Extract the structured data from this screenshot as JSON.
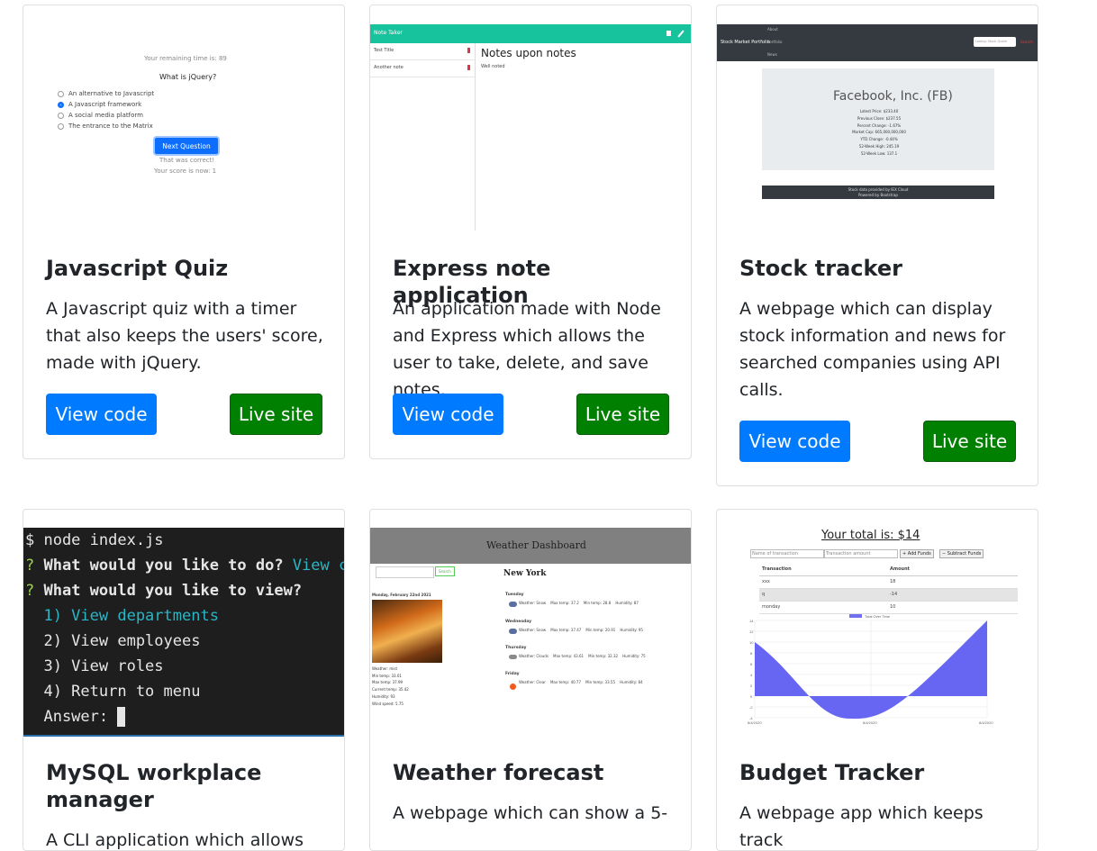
{
  "cards": [
    {
      "title": "Javascript Quiz",
      "text": "A Javascript quiz with a timer that also keeps the users' score, made with jQuery.",
      "view_label": "View code",
      "live_label": "Live site",
      "thumb": {
        "timer": "Your remaining time is: 89",
        "question": "What is jQuery?",
        "options": [
          "An alternative to Javascript",
          "A Javascript framework",
          "A social media platform",
          "The entrance to the Matrix"
        ],
        "button": "Next Question",
        "feedback": "That was correct!",
        "score": "Your score is now: 1"
      }
    },
    {
      "title": "Express note application",
      "text": "An application made with Node and Express which allows the user to take, delete, and save notes.",
      "view_label": "View code",
      "live_label": "Live site",
      "thumb": {
        "brand": "Note Taker",
        "notes": [
          "Test Title",
          "Another note"
        ],
        "heading": "Notes upon notes",
        "body": "Well noted"
      }
    },
    {
      "title": "Stock tracker",
      "text": "A webpage which can display stock information and news for searched companies using API calls.",
      "view_label": "View code",
      "live_label": "Live site",
      "thumb": {
        "brand": "Stock Market Portfolio",
        "nav": [
          "About",
          "Portfolio",
          "News"
        ],
        "search_placeholder": "Lookup Stock Quote",
        "search_btn": "Search",
        "company": "Facebook, Inc. (FB)",
        "stats": [
          "Latest Price: $233.40",
          "Previous Close: $237.55",
          "Percent Change: -1.67%",
          "Market Cap: 665,000,000,000",
          "YTD Change: -0.44%",
          "52-Week High: 245.19",
          "52-Week Low: 137.1"
        ],
        "footer1": "Stock data provided by IEX Cloud",
        "footer2": "Powered by Bootstrap"
      }
    },
    {
      "title": "MySQL workplace manager",
      "text": "A CLI application which allows",
      "thumb": {
        "lines": [
          {
            "a": "$ node index.js",
            "b": ""
          },
          {
            "q": "? ",
            "a": "What would you like to do? ",
            "b": "View current workplace"
          },
          {
            "q": "? ",
            "a": "What would you like to view?",
            "b": ""
          },
          {
            "a": "  1) View departments",
            "b": ""
          },
          {
            "a": "  2) View employees",
            "b": ""
          },
          {
            "a": "  3) View roles",
            "b": ""
          },
          {
            "a": "  4) Return to menu",
            "b": ""
          },
          {
            "a": "  Answer: ",
            "b": ""
          }
        ]
      }
    },
    {
      "title": "Weather forecast",
      "text": "A webpage which can show a 5-",
      "thumb": {
        "header": "Weather Dashboard",
        "search_btn": "Search",
        "city": "New York",
        "date": "Monday, February 22nd 2021",
        "current": [
          "Weather: mist",
          "Min temp: 33.01",
          "Max temp: 37.99",
          "Current temp: 35.42",
          "Humidity: 93",
          "Wind speed: 5.75"
        ],
        "days": [
          {
            "day": "Tuesday",
            "line": "Weather: Snow    Max temp: 37.2    Min temp: 28.8    Humidity: 87"
          },
          {
            "day": "Wednesday",
            "line": "Weather: Snow    Max temp: 37.47    Min temp: 20.91    Humidity: 95"
          },
          {
            "day": "Thursday",
            "line": "Weather: Clouds    Max temp: 43.61    Min temp: 32.32    Humidity: 75"
          },
          {
            "day": "Friday",
            "line": "Weather: Clear    Max temp: 40.77    Min temp: 33.55    Humidity: 84"
          }
        ]
      }
    },
    {
      "title": "Budget Tracker",
      "text": "A webpage app which keeps track",
      "thumb": {
        "total": "Your total is: $14",
        "name_placeholder": "Name of transaction",
        "amount_placeholder": "Transaction amount",
        "add": "+ Add Funds",
        "subtract": "− Subtract Funds",
        "headers": [
          "Transaction",
          "Amount"
        ],
        "rows": [
          [
            "xxx",
            "18"
          ],
          [
            "q",
            "-14"
          ],
          [
            "monday",
            "10"
          ]
        ],
        "legend": "Total Over Time",
        "dates": [
          "8/4/2020",
          "8/4/2020",
          "8/4/2020"
        ],
        "yticks": [
          "14",
          "12",
          "10",
          "8",
          "6",
          "4",
          "2",
          "0",
          "-2",
          "-4"
        ]
      }
    }
  ],
  "colors": {
    "primary": "#007bff",
    "success": "#008000"
  }
}
